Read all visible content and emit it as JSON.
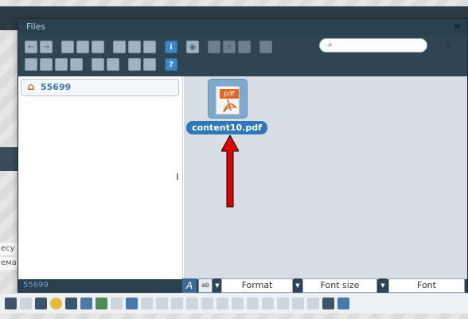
{
  "dialog": {
    "title": "Files",
    "close_label": "✖"
  },
  "toolbar": {
    "search_placeholder": "",
    "search_icon": "search-icon",
    "search_clear": "×"
  },
  "tree": {
    "root_label": "55699",
    "root_icon": "home-icon"
  },
  "file": {
    "name": "content10.pdf",
    "type_tag": "pdf"
  },
  "status": {
    "path": "55699"
  },
  "format_bar": {
    "format_label": "Format",
    "fontsize_label": "Font size",
    "font_label": "Font"
  },
  "background": {
    "label1": "ecy",
    "label2": "ема"
  },
  "colors": {
    "accent": "#2f78b8",
    "dialog_header": "#28404f",
    "arrow": "#e00000"
  }
}
